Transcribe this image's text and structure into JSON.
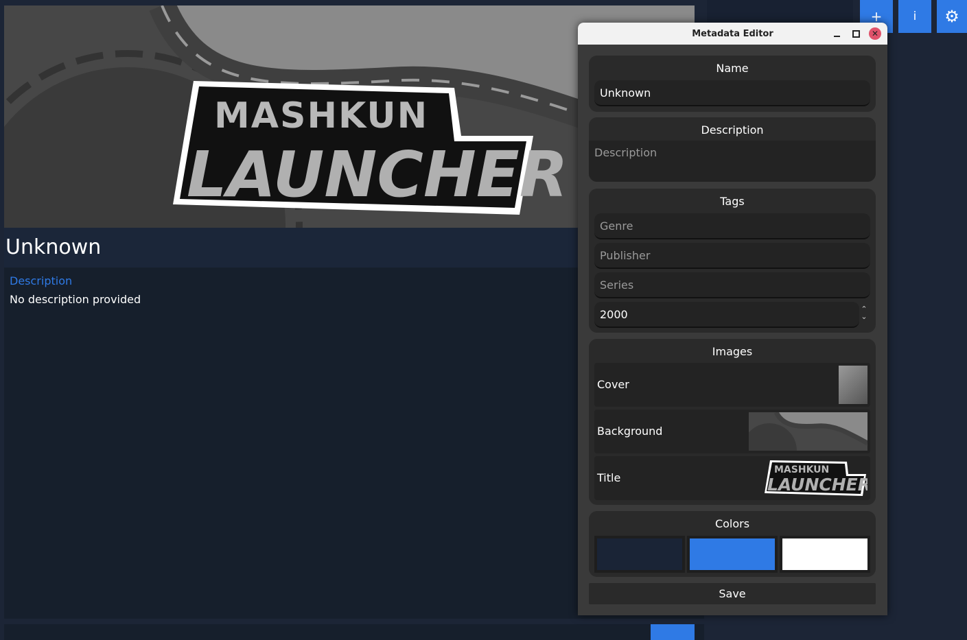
{
  "game": {
    "name": "Unknown",
    "description_heading": "Description",
    "description_text": "No description provided",
    "logo_line1": "MASHKUN",
    "logo_line2": "LAUNCHER"
  },
  "toolbar": {
    "add_label": "+",
    "info_label": "i",
    "settings_label": "⚙"
  },
  "dialog": {
    "title": "Metadata Editor",
    "close_glyph": "✕",
    "name_section": {
      "title": "Name",
      "value": "Unknown"
    },
    "description_section": {
      "title": "Description",
      "placeholder": "Description"
    },
    "tags_section": {
      "title": "Tags",
      "genre_placeholder": "Genre",
      "publisher_placeholder": "Publisher",
      "series_placeholder": "Series",
      "year_value": "2000",
      "spin_up": "⌃",
      "spin_down": "⌄"
    },
    "images_section": {
      "title": "Images",
      "cover_label": "Cover",
      "background_label": "Background",
      "title_label": "Title"
    },
    "colors_section": {
      "title": "Colors",
      "swatches": [
        "#1a2436",
        "#2f7ae5",
        "#ffffff"
      ]
    },
    "save_label": "Save"
  },
  "colors": {
    "accent": "#2f7ae5",
    "background": "#1c2536"
  }
}
